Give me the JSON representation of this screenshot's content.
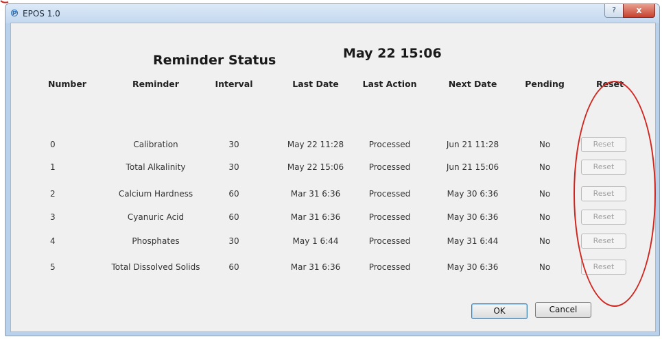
{
  "window": {
    "title": "EPOS 1.0",
    "help_symbol": "?",
    "close_symbol": "x"
  },
  "heading": {
    "title": "Reminder Status",
    "datetime": "May 22 15:06"
  },
  "columns": [
    "Number",
    "Reminder",
    "Interval",
    "Last Date",
    "Last Action",
    "Next Date",
    "Pending",
    "Reset"
  ],
  "rows": [
    {
      "number": "0",
      "reminder": "Calibration",
      "interval": "30",
      "last_date": "May 22 11:28",
      "last_action": "Processed",
      "next_date": "Jun 21 11:28",
      "pending": "No",
      "reset": "Reset"
    },
    {
      "number": "1",
      "reminder": "Total Alkalinity",
      "interval": "30",
      "last_date": "May 22 15:06",
      "last_action": "Processed",
      "next_date": "Jun 21 15:06",
      "pending": "No",
      "reset": "Reset"
    },
    {
      "number": "2",
      "reminder": "Calcium Hardness",
      "interval": "60",
      "last_date": "Mar 31 6:36",
      "last_action": "Processed",
      "next_date": "May 30 6:36",
      "pending": "No",
      "reset": "Reset"
    },
    {
      "number": "3",
      "reminder": "Cyanuric Acid",
      "interval": "60",
      "last_date": "Mar 31 6:36",
      "last_action": "Processed",
      "next_date": "May 30 6:36",
      "pending": "No",
      "reset": "Reset"
    },
    {
      "number": "4",
      "reminder": "Phosphates",
      "interval": "30",
      "last_date": "May 1 6:44",
      "last_action": "Processed",
      "next_date": "May 31 6:44",
      "pending": "No",
      "reset": "Reset"
    },
    {
      "number": "5",
      "reminder": "Total Dissolved Solids",
      "interval": "60",
      "last_date": "Mar 31 6:36",
      "last_action": "Processed",
      "next_date": "May 30 6:36",
      "pending": "No",
      "reset": "Reset"
    }
  ],
  "buttons": {
    "ok": "OK",
    "cancel": "Cancel"
  },
  "colors": {
    "annotation": "#d0251e",
    "titlebar": "#c3d8ef",
    "client": "#f0f0f0"
  }
}
